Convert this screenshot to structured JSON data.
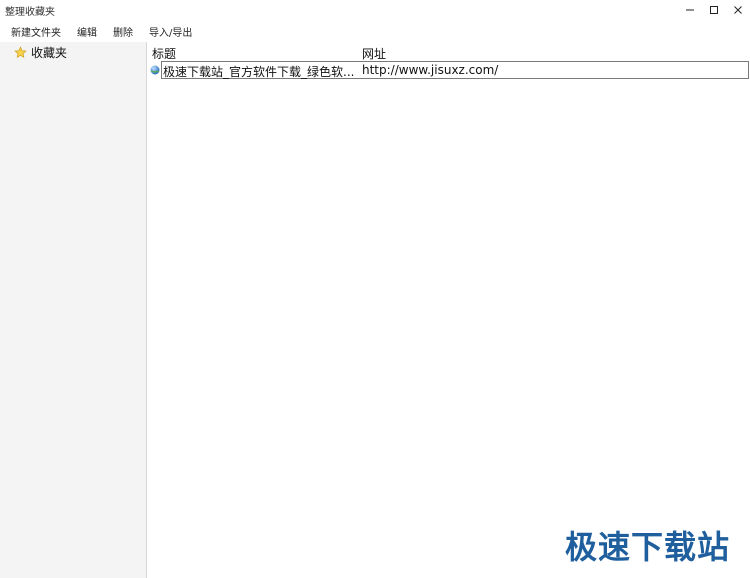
{
  "window": {
    "title": "整理收藏夹"
  },
  "menu": {
    "items": [
      {
        "label": "新建文件夹"
      },
      {
        "label": "编辑"
      },
      {
        "label": "删除"
      },
      {
        "label": "导入/导出"
      }
    ]
  },
  "sidebar": {
    "items": [
      {
        "label": "收藏夹",
        "icon": "star-icon"
      }
    ]
  },
  "list": {
    "headers": {
      "title": "标题",
      "url": "网址"
    },
    "rows": [
      {
        "title": "极速下载站_官方软件下载_绿色软...",
        "url": "http://www.jisuxz.com/",
        "icon": "globe-icon"
      }
    ]
  },
  "watermark": {
    "text": "极速下载站"
  },
  "colors": {
    "accent": "#1f5f9e",
    "sidebar_bg": "#f4f4f4"
  }
}
